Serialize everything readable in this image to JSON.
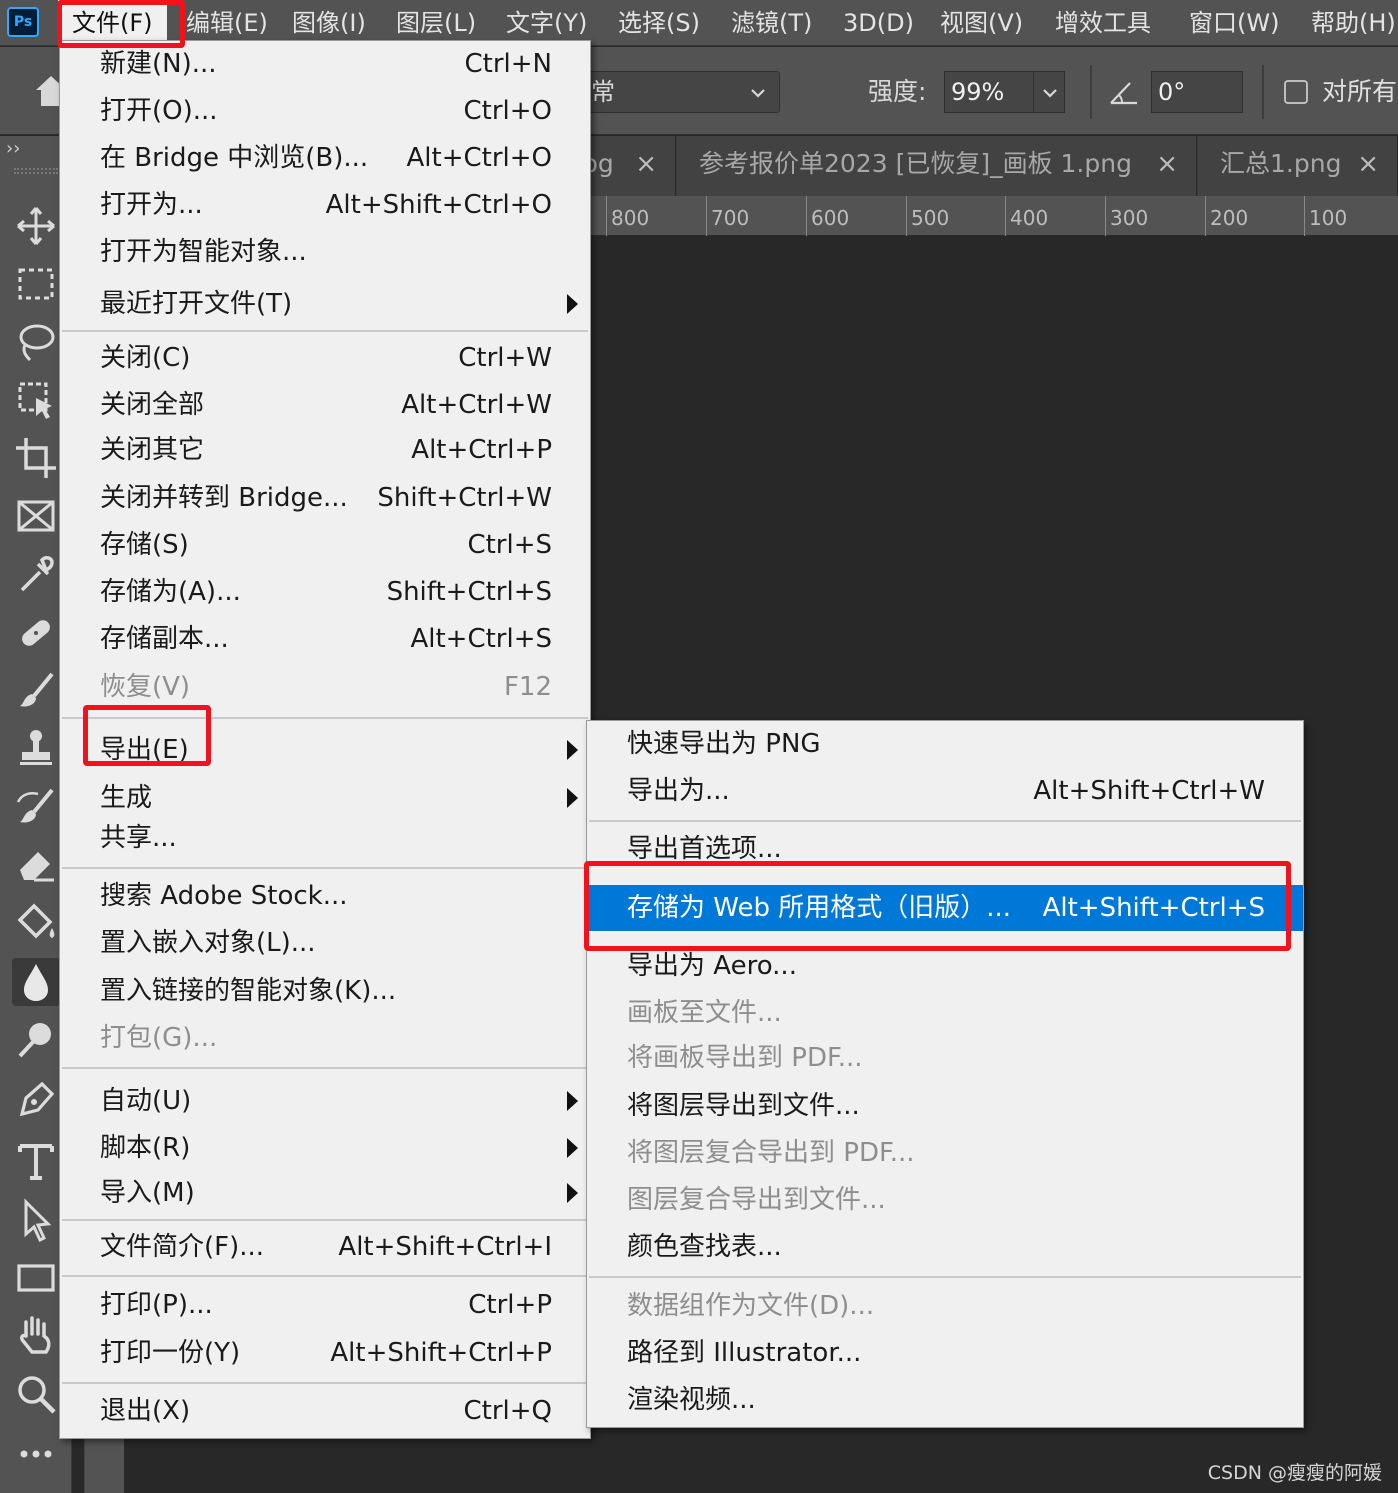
{
  "app": {
    "logo": "Ps"
  },
  "menubar": {
    "items": [
      "文件(F)",
      "编辑(E)",
      "图像(I)",
      "图层(L)",
      "文字(Y)",
      "选择(S)",
      "滤镜(T)",
      "3D(D)",
      "视图(V)",
      "增效工具",
      "窗口(W)",
      "帮助(H)"
    ]
  },
  "options": {
    "mode_value": "常",
    "strength_label": "强度:",
    "strength_value": "99%",
    "angle_value": "0°",
    "all_layers_label": "对所有"
  },
  "tabs": [
    {
      "label": "pg"
    },
    {
      "label": "参考报价单2023 [已恢复]_画板 1.png"
    },
    {
      "label": "汇总1.png"
    }
  ],
  "ruler": {
    "ticks": [
      "800",
      "700",
      "600",
      "500",
      "400",
      "300",
      "200",
      "100"
    ]
  },
  "file_menu": {
    "items": [
      {
        "label": "新建(N)...",
        "shortcut": "Ctrl+N"
      },
      {
        "label": "打开(O)...",
        "shortcut": "Ctrl+O"
      },
      {
        "label": "在 Bridge 中浏览(B)...",
        "shortcut": "Alt+Ctrl+O"
      },
      {
        "label": "打开为...",
        "shortcut": "Alt+Shift+Ctrl+O"
      },
      {
        "label": "打开为智能对象...",
        "shortcut": ""
      },
      {
        "label": "最近打开文件(T)",
        "shortcut": ""
      },
      {
        "label": "关闭(C)",
        "shortcut": "Ctrl+W"
      },
      {
        "label": "关闭全部",
        "shortcut": "Alt+Ctrl+W"
      },
      {
        "label": "关闭其它",
        "shortcut": "Alt+Ctrl+P"
      },
      {
        "label": "关闭并转到 Bridge...",
        "shortcut": "Shift+Ctrl+W"
      },
      {
        "label": "存储(S)",
        "shortcut": "Ctrl+S"
      },
      {
        "label": "存储为(A)...",
        "shortcut": "Shift+Ctrl+S"
      },
      {
        "label": "存储副本...",
        "shortcut": "Alt+Ctrl+S"
      },
      {
        "label": "恢复(V)",
        "shortcut": "F12"
      },
      {
        "label": "导出(E)",
        "shortcut": ""
      },
      {
        "label": "生成",
        "shortcut": ""
      },
      {
        "label": "共享...",
        "shortcut": ""
      },
      {
        "label": "搜索 Adobe Stock...",
        "shortcut": ""
      },
      {
        "label": "置入嵌入对象(L)...",
        "shortcut": ""
      },
      {
        "label": "置入链接的智能对象(K)...",
        "shortcut": ""
      },
      {
        "label": "打包(G)...",
        "shortcut": ""
      },
      {
        "label": "自动(U)",
        "shortcut": ""
      },
      {
        "label": "脚本(R)",
        "shortcut": ""
      },
      {
        "label": "导入(M)",
        "shortcut": ""
      },
      {
        "label": "文件简介(F)...",
        "shortcut": "Alt+Shift+Ctrl+I"
      },
      {
        "label": "打印(P)...",
        "shortcut": "Ctrl+P"
      },
      {
        "label": "打印一份(Y)",
        "shortcut": "Alt+Shift+Ctrl+P"
      },
      {
        "label": "退出(X)",
        "shortcut": "Ctrl+Q"
      }
    ]
  },
  "export_menu": {
    "items": [
      {
        "label": "快速导出为 PNG",
        "shortcut": ""
      },
      {
        "label": "导出为...",
        "shortcut": "Alt+Shift+Ctrl+W"
      },
      {
        "label": "导出首选项...",
        "shortcut": ""
      },
      {
        "label": "存储为 Web 所用格式（旧版）...",
        "shortcut": "Alt+Shift+Ctrl+S"
      },
      {
        "label": "导出为 Aero...",
        "shortcut": ""
      },
      {
        "label": "画板至文件...",
        "shortcut": ""
      },
      {
        "label": "将画板导出到 PDF...",
        "shortcut": ""
      },
      {
        "label": "将图层导出到文件...",
        "shortcut": ""
      },
      {
        "label": "将图层复合导出到 PDF...",
        "shortcut": ""
      },
      {
        "label": "图层复合导出到文件...",
        "shortcut": ""
      },
      {
        "label": "颜色查找表...",
        "shortcut": ""
      },
      {
        "label": "数据组作为文件(D)...",
        "shortcut": ""
      },
      {
        "label": "路径到 Illustrator...",
        "shortcut": ""
      },
      {
        "label": "渲染视频...",
        "shortcut": ""
      }
    ]
  },
  "watermark": "CSDN @瘦瘦的阿媛",
  "colors": {
    "highlight": "#0078d7",
    "annotation_red": "#f0131e",
    "ui_gray": "#535353",
    "canvas": "#282828"
  }
}
